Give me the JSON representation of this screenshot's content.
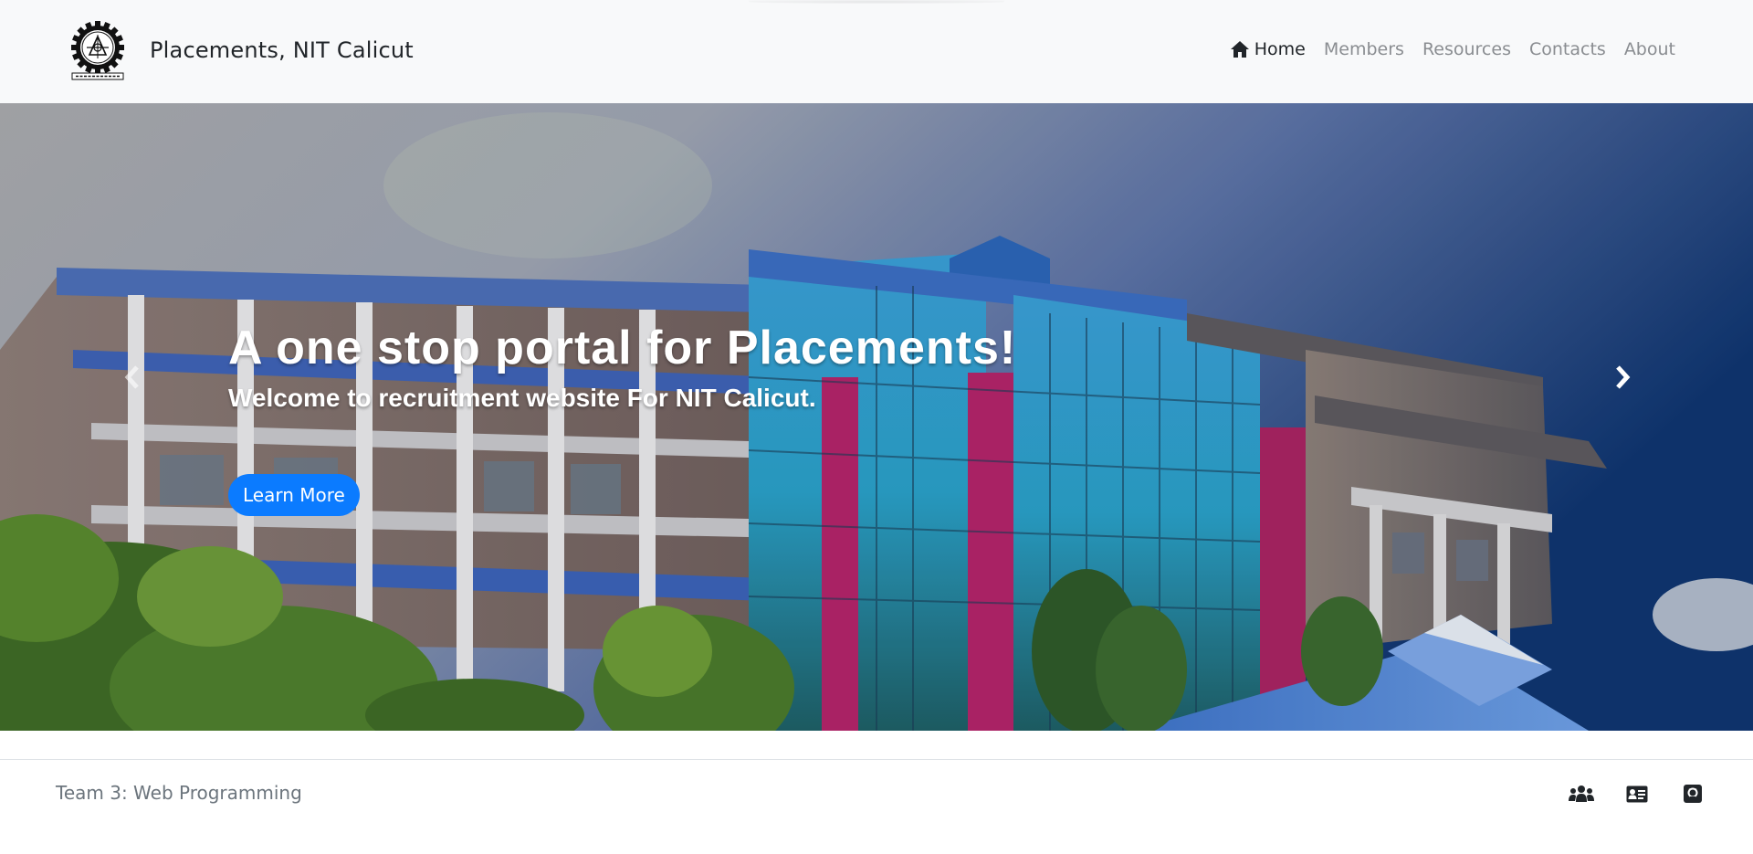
{
  "navbar": {
    "brand_text": "Placements, NIT Calicut",
    "logo_icon": "nit-calicut-emblem-icon",
    "links": [
      {
        "label": "Home",
        "icon": "home-icon",
        "active": true
      },
      {
        "label": "Members"
      },
      {
        "label": "Resources"
      },
      {
        "label": "Contacts"
      },
      {
        "label": "About"
      }
    ]
  },
  "hero": {
    "title": "A one stop portal for Placements!",
    "subtitle": "Welcome to recruitment website For NIT Calicut.",
    "button_label": "Learn More",
    "prev_icon": "chevron-left-icon",
    "next_icon": "chevron-right-icon"
  },
  "footer": {
    "text": "Team 3: Web Programming",
    "icons": [
      "team-icon",
      "id-card-icon",
      "github-icon"
    ]
  },
  "colors": {
    "navbar_bg": "#f8f9fa",
    "brand_text": "#212529",
    "nav_link": "#8a8d91",
    "nav_active": "#212529",
    "button_bg": "#0b7bff",
    "footer_text": "#6c757d"
  }
}
